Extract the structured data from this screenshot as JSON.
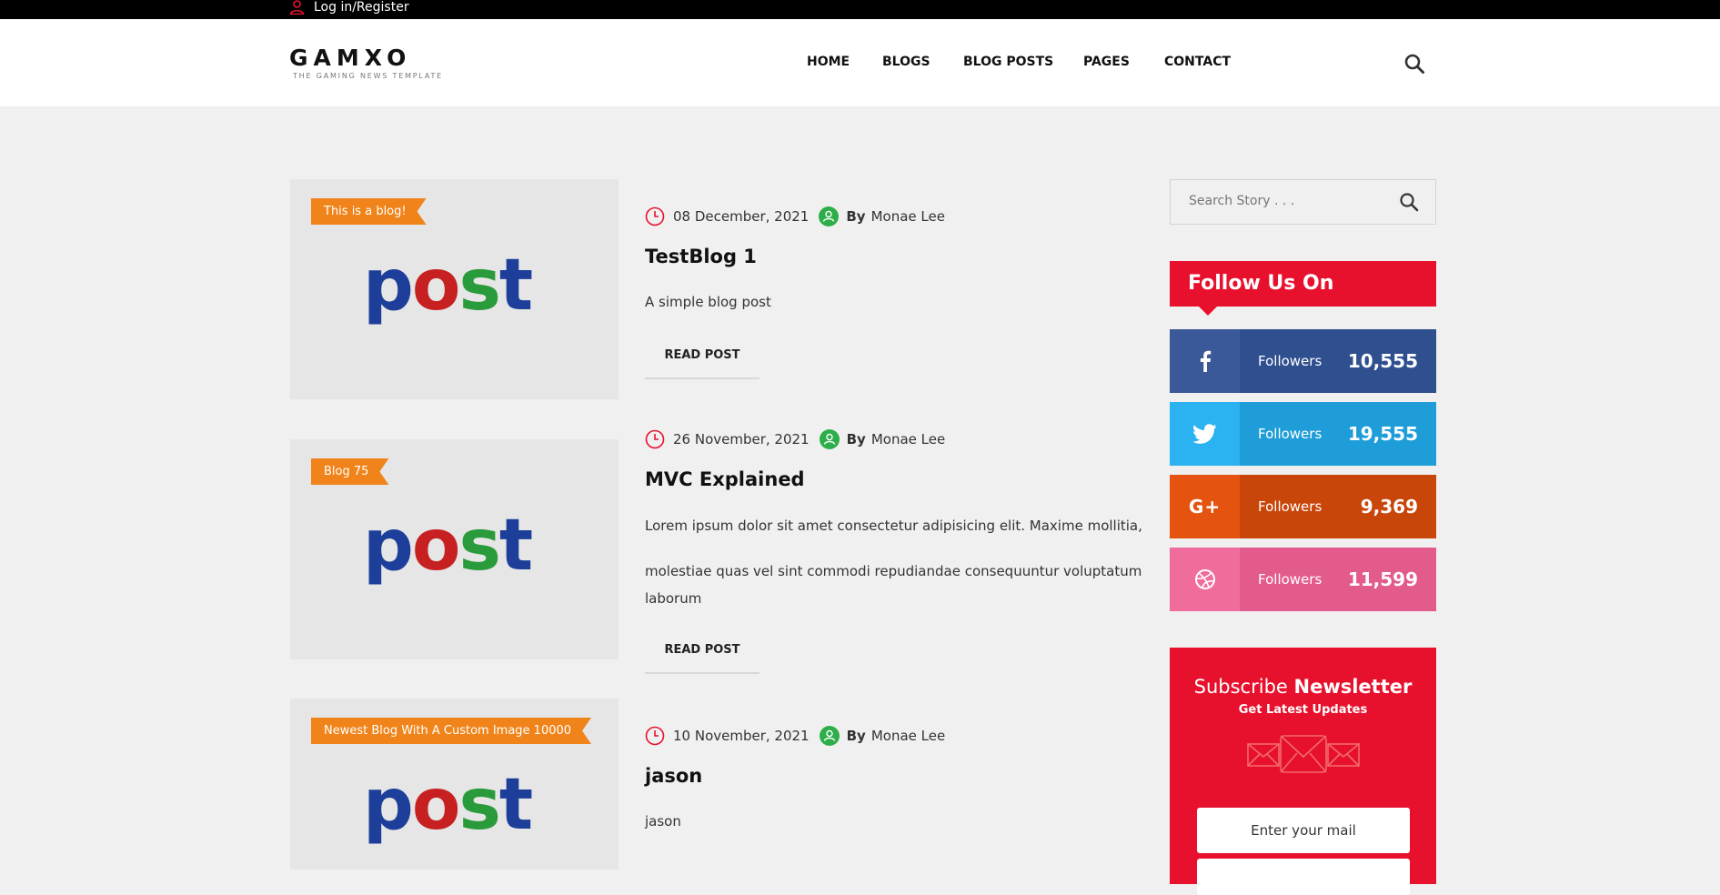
{
  "topbar": {
    "login_label": "Log in/Register"
  },
  "logo": {
    "word": "GAMXO",
    "tagline": "THE GAMING NEWS TEMPLATE"
  },
  "nav": {
    "items": [
      "HOME",
      "BLOGS",
      "BLOG POSTS",
      "PAGES",
      "CONTACT"
    ]
  },
  "posts": [
    {
      "ribbon": "This is a blog!",
      "image_word": "post",
      "date": "08 December, 2021",
      "by": "By",
      "author": "Monae Lee",
      "title": "TestBlog 1",
      "excerpt": [
        "A simple blog post"
      ],
      "button": "READ POST"
    },
    {
      "ribbon": "Blog 75",
      "image_word": "post",
      "date": "26 November, 2021",
      "by": "By",
      "author": "Monae Lee",
      "title": "MVC Explained",
      "excerpt": [
        "Lorem ipsum dolor sit amet consectetur adipisicing elit. Maxime mollitia,",
        "molestiae quas vel sint commodi repudiandae consequuntur voluptatum laborum"
      ],
      "button": "READ POST"
    },
    {
      "ribbon": "Newest Blog With A Custom Image 10000",
      "image_word": "post",
      "date": "10 November, 2021",
      "by": "By",
      "author": "Monae Lee",
      "title": "jason",
      "excerpt": [
        "jason"
      ],
      "button": ""
    }
  ],
  "sidebar": {
    "search_placeholder": "Search Story . . .",
    "follow_title": "Follow Us On",
    "social": [
      {
        "icon": "facebook-icon",
        "label": "Followers",
        "count": "10,555",
        "color_icon": "#3b5998",
        "color_body": "#2f4f8f"
      },
      {
        "icon": "twitter-icon",
        "label": "Followers",
        "count": "19,555",
        "color_icon": "#2ab3f0",
        "color_body": "#1e9dd8"
      },
      {
        "icon": "google-plus-icon",
        "label": "Followers",
        "count": "9,369",
        "color_icon": "#e55310",
        "color_body": "#c9460b"
      },
      {
        "icon": "dribbble-icon",
        "label": "Followers",
        "count": "11,599",
        "color_icon": "#f06c9c",
        "color_body": "#e35b8c"
      }
    ],
    "newsletter": {
      "title_light": "Subscribe",
      "title_bold": "Newsletter",
      "subtitle": "Get Latest Updates",
      "input_placeholder": "Enter your mail"
    }
  },
  "colors": {
    "accent": "#e8112d",
    "ribbon": "#f0841b",
    "date_icon": "#e8112d",
    "author_icon": "#2eae4a"
  }
}
